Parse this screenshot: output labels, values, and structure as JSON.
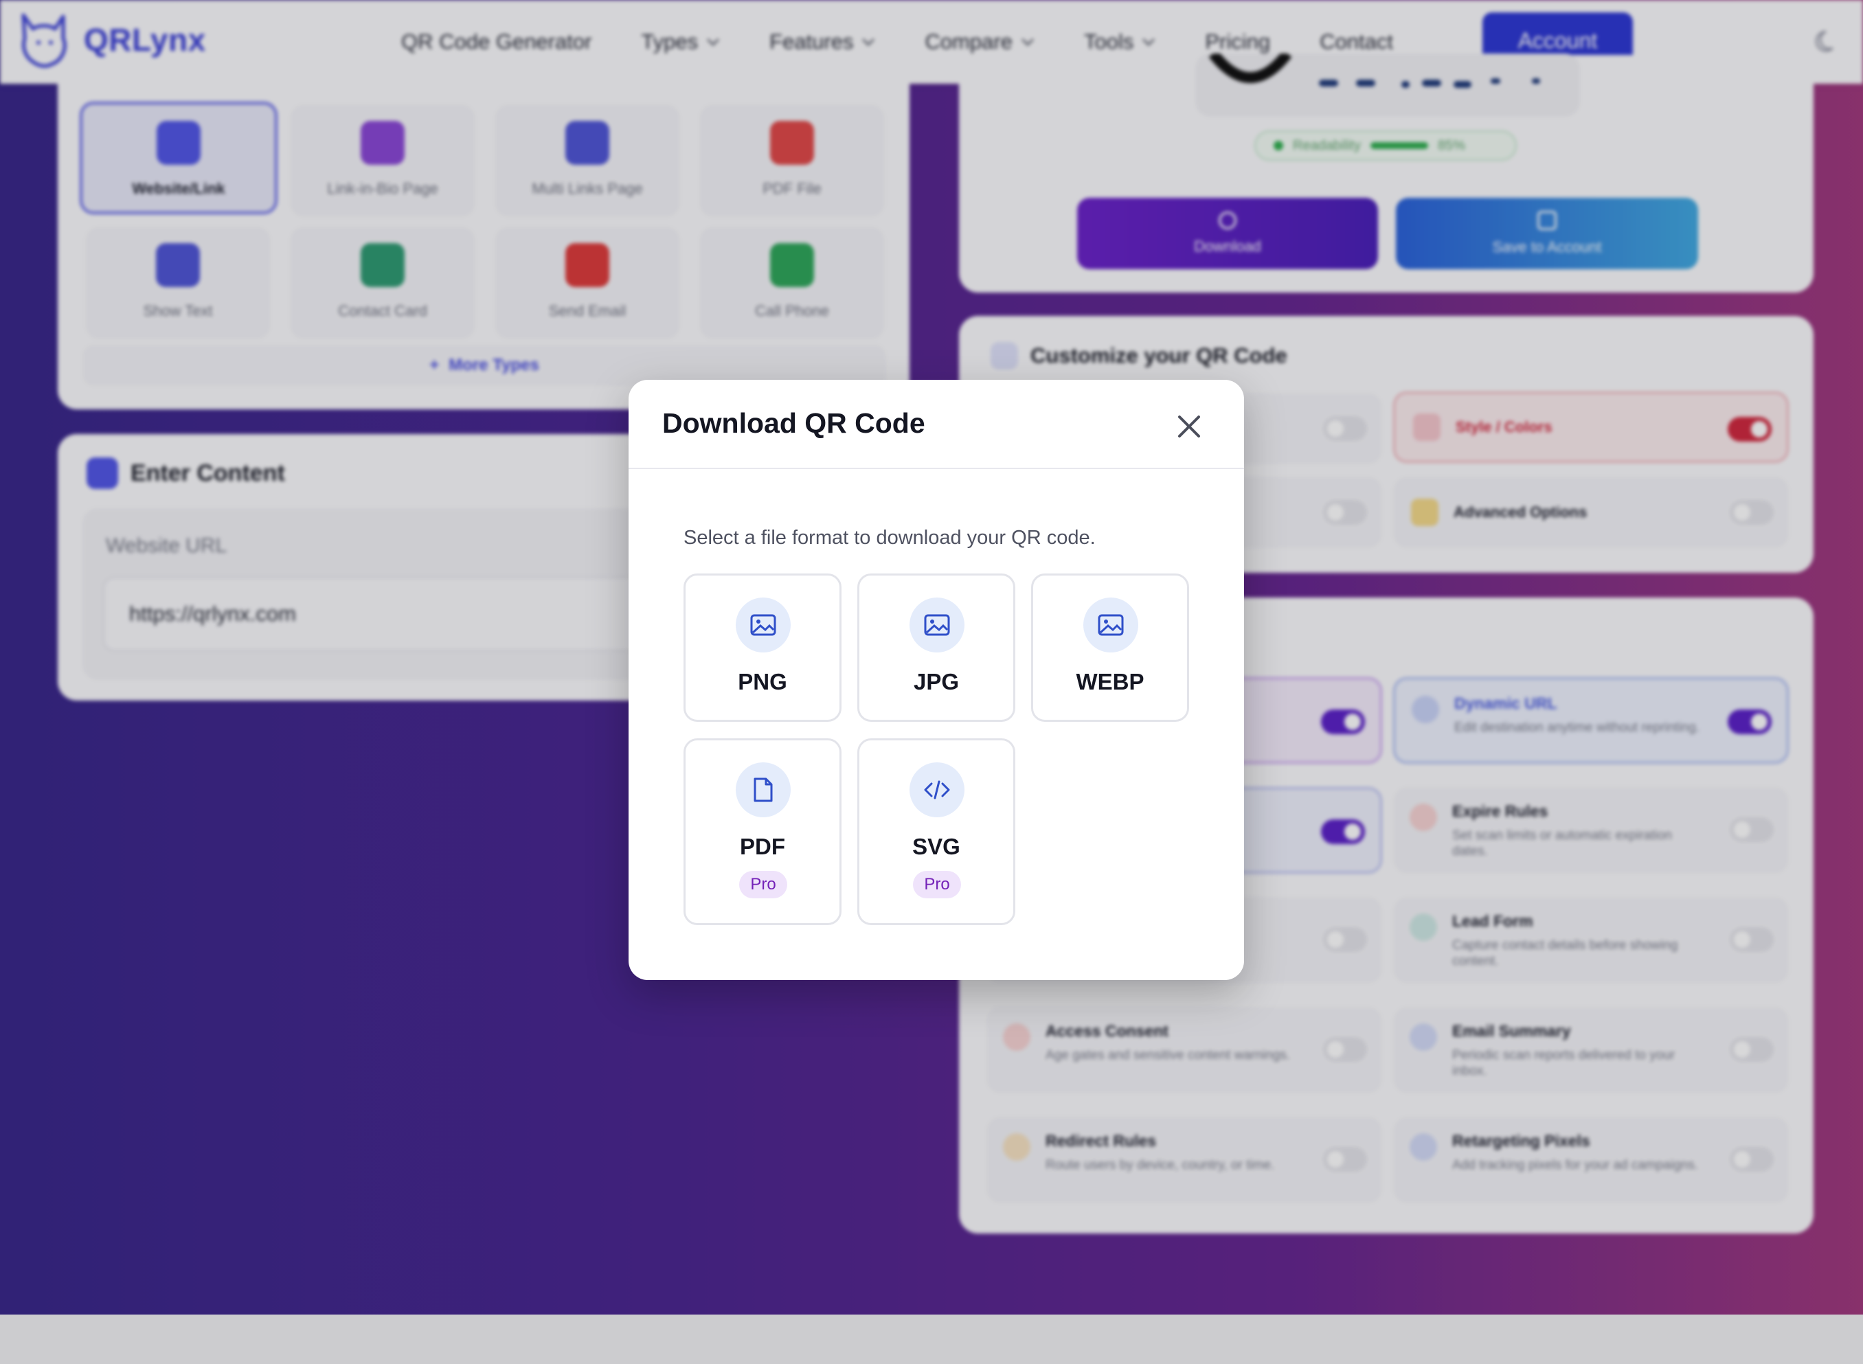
{
  "app": {
    "name": "QRLynx"
  },
  "nav": {
    "items": [
      {
        "label": "QR Code Generator",
        "dropdown": false
      },
      {
        "label": "Types",
        "dropdown": true
      },
      {
        "label": "Features",
        "dropdown": true
      },
      {
        "label": "Compare",
        "dropdown": true
      },
      {
        "label": "Tools",
        "dropdown": true
      },
      {
        "label": "Pricing",
        "dropdown": false
      },
      {
        "label": "Contact",
        "dropdown": false
      }
    ],
    "account_label": "Account"
  },
  "types": {
    "tiles": [
      {
        "label": "Website/Link",
        "color": "#5156e6",
        "active": true
      },
      {
        "label": "Link-in-Bio Page",
        "color": "#8a47d6"
      },
      {
        "label": "Multi Links Page",
        "color": "#4f55d6"
      },
      {
        "label": "PDF File",
        "color": "#e04848"
      },
      {
        "label": "Show Text",
        "color": "#4f55d6"
      },
      {
        "label": "Contact Card",
        "color": "#2e9a72"
      },
      {
        "label": "Send Email",
        "color": "#dd3b3b"
      },
      {
        "label": "Call Phone",
        "color": "#2ea65a"
      }
    ],
    "more_label": "More Types"
  },
  "content": {
    "title": "Enter Content",
    "url_label": "Website URL",
    "url_value": "https://qrlynx.com"
  },
  "preview": {
    "readability_label": "Readability",
    "readability_value": "85%",
    "readability_fraction": 0.85,
    "download_label": "Download",
    "save_label": "Save to Account"
  },
  "customize": {
    "title": "Customize your QR Code",
    "options": [
      {
        "label": "Style / Colors",
        "on": true
      },
      {
        "label": "Advanced Options",
        "on": false
      }
    ]
  },
  "features": [
    {
      "title": "Dynamic URL",
      "desc": "Edit destination anytime without reprinting.",
      "on": true,
      "color": "#4b5de0"
    },
    {
      "title": "Expire Rules",
      "desc": "Set scan limits or automatic expiration dates.",
      "on": false,
      "color": "#e05a5a"
    },
    {
      "title": "Lead Form",
      "desc": "Capture contact details before showing content.",
      "on": false,
      "color": "#2e9a8a"
    },
    {
      "title": "Access Consent",
      "desc": "Age gates and sensitive content warnings.",
      "on": false,
      "color": "#e05a5a"
    },
    {
      "title": "Email Summary",
      "desc": "Periodic scan reports delivered to your inbox.",
      "on": false,
      "color": "#4b5de0"
    },
    {
      "title": "Redirect Rules",
      "desc": "Route users by device, country, or time.",
      "on": false,
      "color": "#e0a040"
    },
    {
      "title": "Retargeting Pixels",
      "desc": "Add tracking pixels for your ad campaigns.",
      "on": false,
      "color": "#4b5de0"
    }
  ],
  "modal": {
    "title": "Download QR Code",
    "subtitle": "Select a file format to download your QR code.",
    "formats": [
      {
        "name": "PNG",
        "icon": "image-icon",
        "pro": false
      },
      {
        "name": "JPG",
        "icon": "image-icon",
        "pro": false
      },
      {
        "name": "WEBP",
        "icon": "image-icon",
        "pro": false
      },
      {
        "name": "PDF",
        "icon": "file-icon",
        "pro": true,
        "badge": "Pro"
      },
      {
        "name": "SVG",
        "icon": "code-icon",
        "pro": true,
        "badge": "Pro"
      }
    ]
  },
  "colors": {
    "brand": "#3b40d6",
    "account_button": "#2d37d3",
    "icon_blue": "#2f4fc9",
    "pro_badge": "#7422b8"
  }
}
